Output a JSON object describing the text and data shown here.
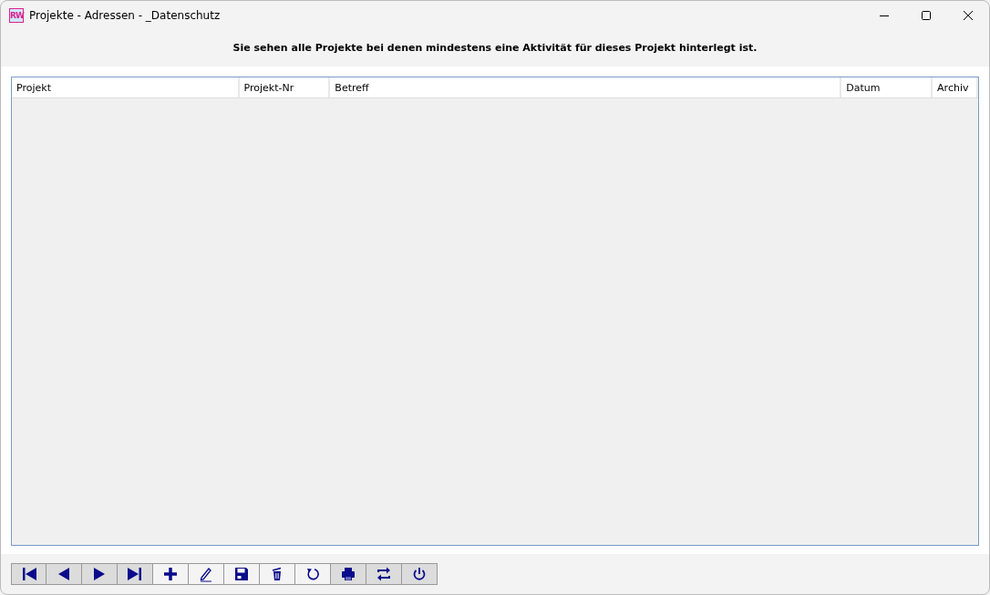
{
  "window": {
    "logo": "RW",
    "title": "Projekte - Adressen - _Datenschutz"
  },
  "info_text": "Sie sehen alle Projekte bei denen mindestens eine Aktivität für dieses Projekt hinterlegt ist.",
  "table": {
    "columns": [
      "Projekt",
      "Projekt-Nr",
      "Betreff",
      "Datum",
      "Archiv"
    ]
  },
  "toolbar": [
    {
      "kind": "first",
      "shaded": true
    },
    {
      "kind": "prev",
      "shaded": true
    },
    {
      "kind": "next",
      "shaded": true
    },
    {
      "kind": "last",
      "shaded": true
    },
    {
      "kind": "add",
      "shaded": false
    },
    {
      "kind": "edit",
      "shaded": false
    },
    {
      "kind": "save",
      "shaded": false
    },
    {
      "kind": "delete",
      "shaded": false
    },
    {
      "kind": "undo",
      "shaded": false
    },
    {
      "kind": "print",
      "shaded": true
    },
    {
      "kind": "swap",
      "shaded": true
    },
    {
      "kind": "power",
      "shaded": true
    }
  ]
}
